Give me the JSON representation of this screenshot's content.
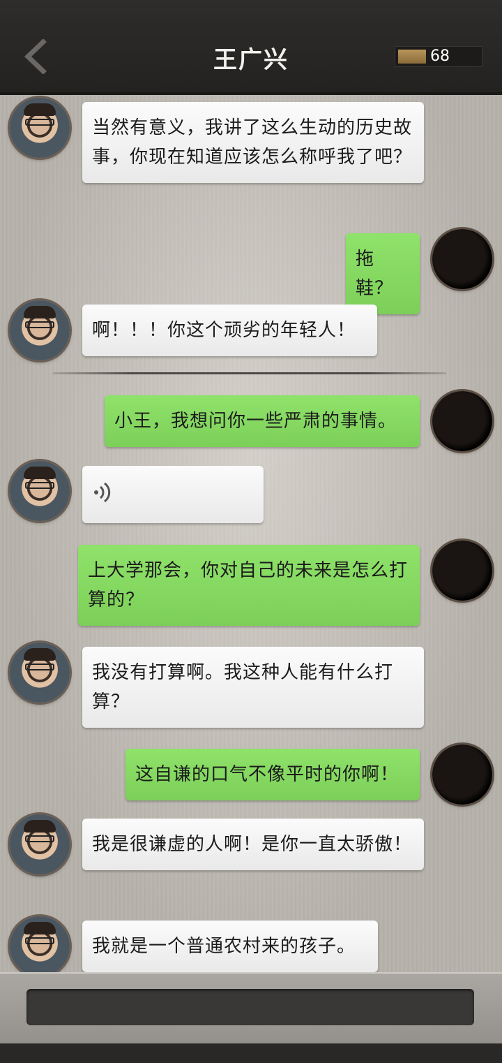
{
  "header": {
    "title": "王广兴",
    "coins": "68",
    "back_icon": "chevron-left-icon"
  },
  "messages": [
    {
      "side": "left",
      "text": "当然有意义，我讲了这么生动的历史故事，你现在知道应该怎么称呼我了吧？"
    },
    {
      "side": "right",
      "text": "拖鞋？"
    },
    {
      "side": "left",
      "text": "啊！！！你这个顽劣的年轻人！"
    },
    {
      "side": "right",
      "text": "小王，我想问你一些严肃的事情。"
    },
    {
      "side": "left",
      "type": "voice",
      "icon": "voice-icon"
    },
    {
      "side": "right",
      "text": "上大学那会，你对自己的未来是怎么打算的？"
    },
    {
      "side": "left",
      "text": "我没有打算啊。我这种人能有什么打算？"
    },
    {
      "side": "right",
      "text": "这自谦的口气不像平时的你啊！"
    },
    {
      "side": "left",
      "text": "我是很谦虚的人啊！是你一直太骄傲！"
    },
    {
      "side": "left",
      "text": "我就是一个普通农村来的孩子。"
    }
  ],
  "colors": {
    "header_bg": "#2f2d2b",
    "left_bubble": "#f4f4f4",
    "right_bubble": "#86d962",
    "coin_bar": "#b8955a"
  }
}
